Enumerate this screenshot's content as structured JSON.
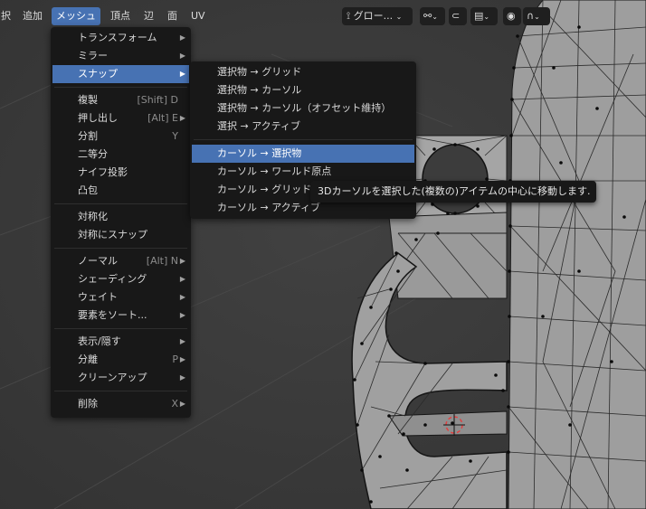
{
  "header": {
    "menus": [
      "択",
      "追加",
      "メッシュ",
      "頂点",
      "辺",
      "面",
      "UV"
    ],
    "active_menu": "メッシュ",
    "transform_orientation": "グロー..."
  },
  "mesh_menu": {
    "items": [
      {
        "label": "トランスフォーム",
        "shortcut": "",
        "submenu": true
      },
      {
        "label": "ミラー",
        "shortcut": "",
        "submenu": true
      },
      {
        "label": "スナップ",
        "shortcut": "",
        "submenu": true,
        "highlighted": true
      },
      {
        "label": "複製",
        "shortcut": "[Shift] D",
        "submenu": false
      },
      {
        "label": "押し出し",
        "shortcut": "[Alt] E",
        "submenu": true
      },
      {
        "label": "分割",
        "shortcut": "Y",
        "submenu": false
      },
      {
        "label": "二等分",
        "shortcut": "",
        "submenu": false
      },
      {
        "label": "ナイフ投影",
        "shortcut": "",
        "submenu": false
      },
      {
        "label": "凸包",
        "shortcut": "",
        "submenu": false
      },
      {
        "label": "対称化",
        "shortcut": "",
        "submenu": false
      },
      {
        "label": "対称にスナップ",
        "shortcut": "",
        "submenu": false
      },
      {
        "label": "ノーマル",
        "shortcut": "[Alt] N",
        "submenu": true
      },
      {
        "label": "シェーディング",
        "shortcut": "",
        "submenu": true
      },
      {
        "label": "ウェイト",
        "shortcut": "",
        "submenu": true
      },
      {
        "label": "要素をソート...",
        "shortcut": "",
        "submenu": true
      },
      {
        "label": "表示/隠す",
        "shortcut": "",
        "submenu": true
      },
      {
        "label": "分離",
        "shortcut": "P",
        "submenu": true
      },
      {
        "label": "クリーンアップ",
        "shortcut": "",
        "submenu": true
      },
      {
        "label": "削除",
        "shortcut": "X",
        "submenu": true
      }
    ]
  },
  "snap_submenu": {
    "items": [
      {
        "label": "選択物 → グリッド"
      },
      {
        "label": "選択物 → カーソル"
      },
      {
        "label": "選択物 → カーソル（オフセット維持）"
      },
      {
        "label": "選択 → アクティブ"
      },
      {
        "label": "カーソル → 選択物",
        "highlighted": true
      },
      {
        "label": "カーソル → ワールド原点"
      },
      {
        "label": "カーソル → グリッド"
      },
      {
        "label": "カーソル → アクティブ"
      }
    ]
  },
  "tooltip": {
    "text": "3Dカーソルを選択した(複数の)アイテムの中心に移動します."
  },
  "colors": {
    "accent": "#4772b3",
    "menu_bg": "#181818",
    "viewport_bg": "#3a3a3a",
    "mesh": "#a3a3a3"
  },
  "icons": [
    "transform-orientation-icon",
    "pivot-icon",
    "snap-icon",
    "snap-target-icon",
    "proportional-icon",
    "falloff-icon"
  ]
}
